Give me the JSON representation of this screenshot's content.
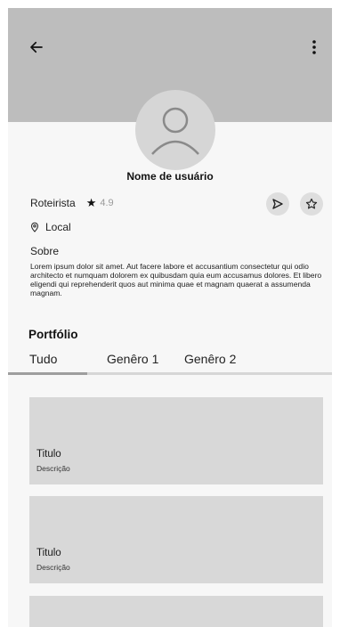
{
  "header": {
    "back_icon": "arrow-left-icon",
    "menu_icon": "more-vertical-icon"
  },
  "profile": {
    "username": "Nome de usuário",
    "role": "Roteirista",
    "rating": "4.9",
    "rating_icon": "star-icon",
    "location": "Local",
    "location_icon": "map-pin-icon",
    "about_label": "Sobre",
    "bio": "Lorem ipsum dolor sit amet. Aut facere labore et accusantium consectetur qui odio architecto et numquam dolorem ex quibusdam quia eum accusamus dolores. Et libero eligendi qui reprehenderit quos aut minima quae et magnam quaerat a assumenda magnam.",
    "send_icon": "send-icon",
    "favorite_icon": "star-outline-icon"
  },
  "portfolio": {
    "title": "Portfólio",
    "tabs": [
      {
        "label": "Tudo",
        "selected": true
      },
      {
        "label": "Genêro 1",
        "selected": false
      },
      {
        "label": "Genêro 2",
        "selected": false
      }
    ],
    "items": [
      {
        "title": "Titulo",
        "description": "Descrição"
      },
      {
        "title": "Titulo",
        "description": "Descrição"
      },
      {
        "title": "",
        "description": ""
      }
    ]
  },
  "colors": {
    "header_bg": "#bdbdbd",
    "avatar_bg": "#d6d6d6",
    "card_bg": "#d8d8d8",
    "tab_indicator": "#9e9e9e"
  }
}
